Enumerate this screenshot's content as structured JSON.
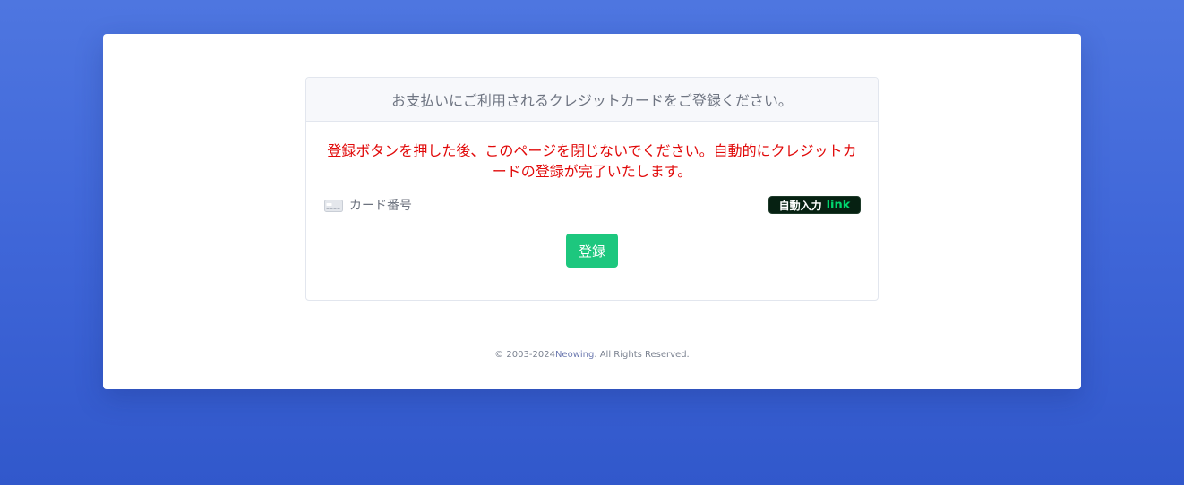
{
  "payment": {
    "header": "お支払いにご利用されるクレジットカードをご登録ください。",
    "warning": "登録ボタンを押した後、このページを閉じないでください。自動的にクレジットカードの登録が完了いたします。",
    "card_field": {
      "icon": "credit-card-icon",
      "placeholder": "カード番号"
    },
    "autofill": {
      "label": "自動入力",
      "brand": "link",
      "brand_color": "#00d66f"
    },
    "register_label": "登録"
  },
  "footer": {
    "copyright": "© 2003-2024",
    "company": "Neowing",
    "rights": ". All Rights Reserved."
  },
  "colors": {
    "background": "#4e76e0",
    "warning": "#e10a0a",
    "register_button": "#1dc77e"
  }
}
